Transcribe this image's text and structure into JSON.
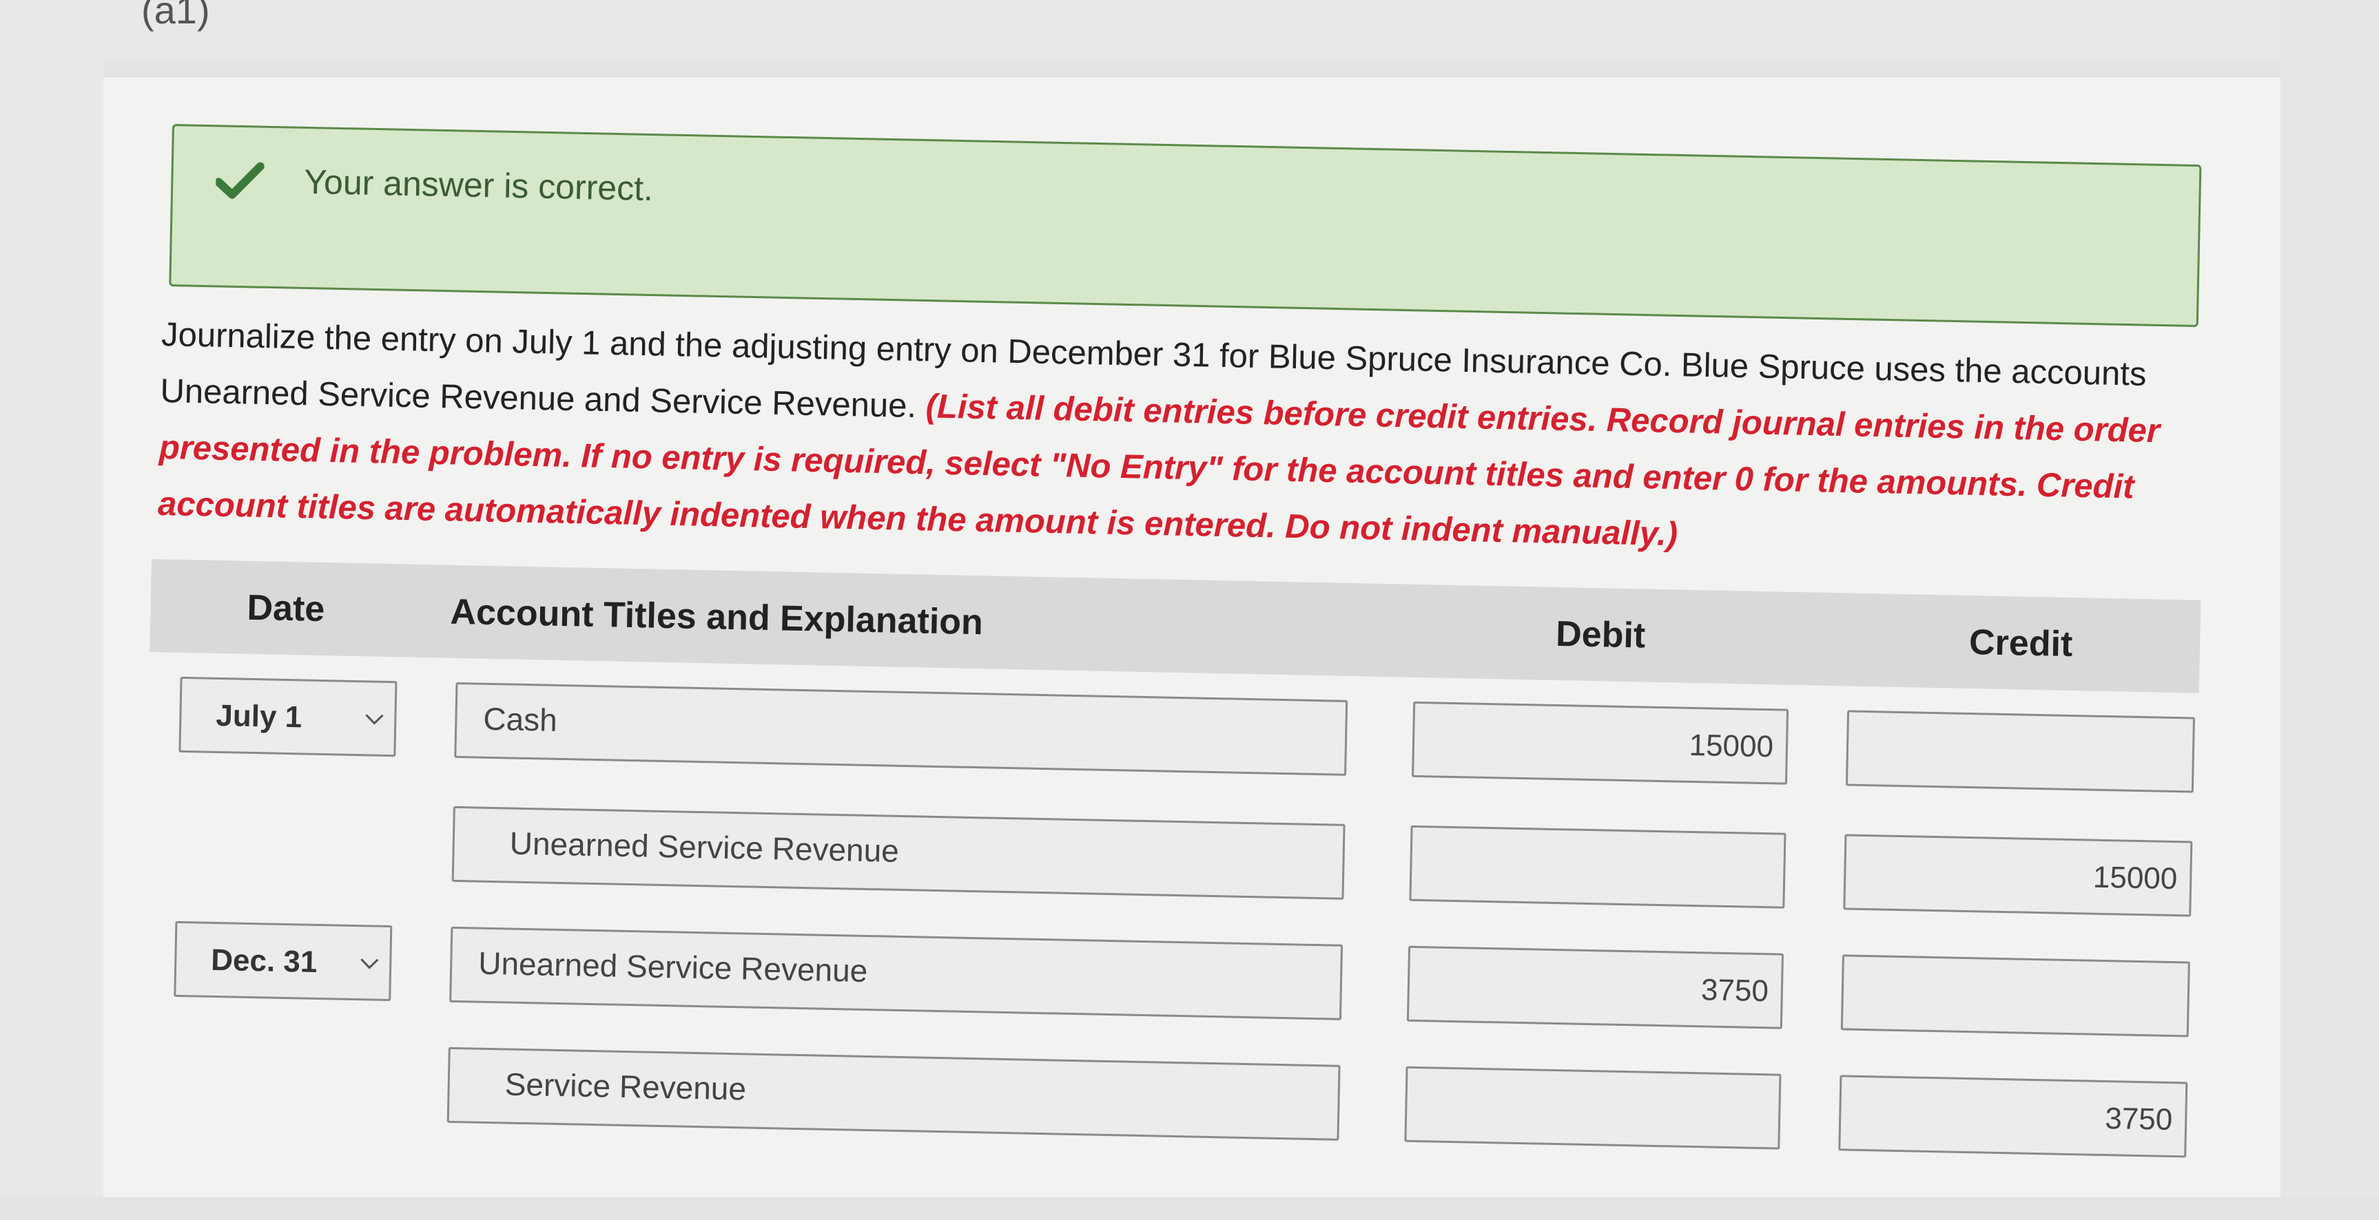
{
  "part_label": "(a1)",
  "banner": {
    "message": "Your answer is correct.",
    "icon": "check-icon",
    "accent": "#3c7a3c"
  },
  "instructions": {
    "normal": "Journalize the entry on July 1 and the adjusting entry on December 31 for Blue Spruce Insurance Co. Blue Spruce uses the accounts Unearned Service Revenue and Service Revenue.",
    "emphasis": "(List all debit entries before credit entries. Record journal entries in the order presented in the problem. If no entry is required, select \"No Entry\" for the account titles and enter 0 for the amounts. Credit account titles are automatically indented when the amount is entered. Do not indent manually.)",
    "emphasis_color": "#d4212f"
  },
  "table": {
    "headers": {
      "date": "Date",
      "account": "Account Titles and Explanation",
      "debit": "Debit",
      "credit": "Credit"
    },
    "rows": [
      {
        "date": "July 1",
        "account": "Cash",
        "debit": "15000",
        "credit": ""
      },
      {
        "date": "",
        "account": "Unearned Service Revenue",
        "debit": "",
        "credit": "15000"
      },
      {
        "date": "Dec. 31",
        "account": "Unearned Service Revenue",
        "debit": "3750",
        "credit": ""
      },
      {
        "date": "",
        "account": "Service Revenue",
        "debit": "",
        "credit": "3750"
      }
    ]
  }
}
